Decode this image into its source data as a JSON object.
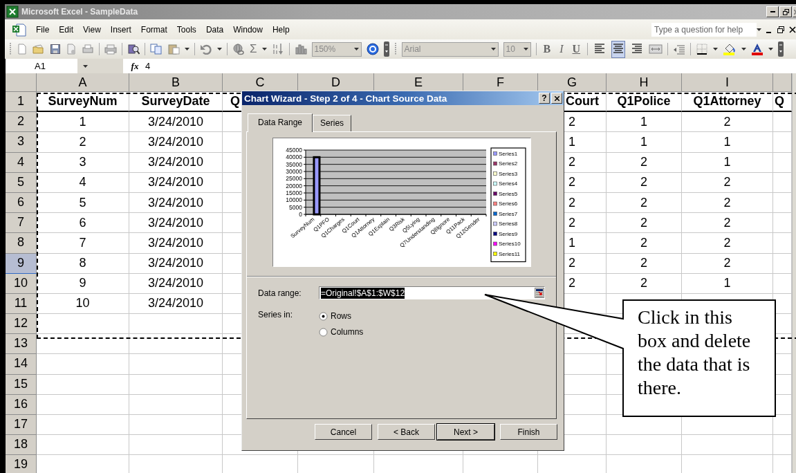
{
  "window": {
    "title": "Microsoft Excel - SampleData"
  },
  "menu": {
    "items": [
      "File",
      "Edit",
      "View",
      "Insert",
      "Format",
      "Tools",
      "Data",
      "Window",
      "Help"
    ],
    "help_search": {
      "placeholder": "Type a question for help"
    }
  },
  "toolbar": {
    "autosum": "Σ",
    "zoom": "150%",
    "font": "Arial",
    "font_size": "10",
    "styles": [
      "B",
      "I",
      "U"
    ],
    "alignment_buttons": [
      {
        "kind": "left",
        "pressed": false
      },
      {
        "kind": "center",
        "pressed": true
      },
      {
        "kind": "right",
        "pressed": false
      }
    ]
  },
  "formula_bar": {
    "cell": "A1",
    "fx": "fx",
    "value": "4"
  },
  "sheet": {
    "columns": [
      "A",
      "B",
      "C",
      "D",
      "E",
      "F",
      "G",
      "H",
      "I"
    ],
    "rows": [
      {
        "label": "1",
        "selected": false,
        "cells": [
          "SurveyNum",
          "SurveyDate",
          "Q",
          null,
          null,
          null,
          "Court",
          "Q1Police",
          "Q1Attorney",
          "Q"
        ]
      },
      {
        "label": "2",
        "selected": false,
        "cells": [
          "1",
          "3/24/2010",
          null,
          null,
          null,
          null,
          "2",
          "1",
          "2",
          null
        ]
      },
      {
        "label": "3",
        "selected": false,
        "cells": [
          "2",
          "3/24/2010",
          null,
          null,
          null,
          null,
          "1",
          "1",
          "1",
          null
        ]
      },
      {
        "label": "4",
        "selected": false,
        "cells": [
          "3",
          "3/24/2010",
          null,
          null,
          null,
          null,
          "2",
          "2",
          "1",
          null
        ]
      },
      {
        "label": "5",
        "selected": false,
        "cells": [
          "4",
          "3/24/2010",
          null,
          null,
          null,
          null,
          "2",
          "2",
          "2",
          null
        ]
      },
      {
        "label": "6",
        "selected": false,
        "cells": [
          "5",
          "3/24/2010",
          null,
          null,
          null,
          null,
          "2",
          "2",
          "2",
          null
        ]
      },
      {
        "label": "7",
        "selected": false,
        "cells": [
          "6",
          "3/24/2010",
          null,
          null,
          null,
          null,
          "2",
          "2",
          "2",
          null
        ]
      },
      {
        "label": "8",
        "selected": false,
        "cells": [
          "7",
          "3/24/2010",
          null,
          null,
          null,
          null,
          "1",
          "2",
          "2",
          null
        ]
      },
      {
        "label": "9",
        "selected": true,
        "cells": [
          "8",
          "3/24/2010",
          null,
          null,
          null,
          null,
          "2",
          "2",
          "2",
          null
        ]
      },
      {
        "label": "10",
        "selected": false,
        "cells": [
          "9",
          "3/24/2010",
          null,
          null,
          null,
          null,
          "2",
          "2",
          "1",
          null
        ]
      },
      {
        "label": "11",
        "selected": false,
        "cells": [
          "10",
          "3/24/2010",
          null,
          null,
          null,
          null,
          null,
          null,
          null,
          null
        ]
      },
      {
        "label": "12",
        "selected": false
      },
      {
        "label": "13",
        "selected": false
      },
      {
        "label": "14",
        "selected": false
      },
      {
        "label": "15",
        "selected": false
      },
      {
        "label": "16",
        "selected": false
      },
      {
        "label": "17",
        "selected": false
      },
      {
        "label": "18",
        "selected": false
      },
      {
        "label": "19",
        "selected": false
      }
    ]
  },
  "dialog": {
    "title": "Chart Wizard - Step 2 of 4 - Chart Source Data",
    "help_button": "?",
    "tabs": [
      {
        "label": "Data Range",
        "selected": true
      },
      {
        "label": "Series",
        "selected": false
      }
    ],
    "preview": {
      "chart_data": {
        "type": "bar",
        "categories": [
          "SurveyNum",
          "Q1PFO",
          "Q1Charges",
          "Q1Court",
          "Q1Attorney",
          "Q1Explain",
          "Q3Risk",
          "Q5Lying",
          "Q7Understanding",
          "Q8Ignore",
          "Q11Pack",
          "Q12Gender"
        ],
        "grid": true,
        "ylim": [
          0,
          45000
        ],
        "yticks": [
          0,
          5000,
          10000,
          15000,
          20000,
          25000,
          30000,
          35000,
          40000,
          45000
        ],
        "series": [
          {
            "name": "Series1",
            "color": "#9999ff",
            "values": [
              40000,
              null,
              null,
              null,
              null,
              null,
              null,
              null,
              null,
              null,
              null,
              null
            ]
          },
          {
            "name": "Series2",
            "color": "#993366",
            "values": [
              null,
              null,
              null,
              null,
              null,
              null,
              null,
              null,
              null,
              null,
              null,
              null
            ]
          },
          {
            "name": "Series3",
            "color": "#ffffcc",
            "values": [
              null,
              null,
              null,
              null,
              null,
              null,
              null,
              null,
              null,
              null,
              null,
              null
            ]
          },
          {
            "name": "Series4",
            "color": "#ccffff",
            "values": [
              null,
              null,
              null,
              null,
              null,
              null,
              null,
              null,
              null,
              null,
              null,
              null
            ]
          },
          {
            "name": "Series5",
            "color": "#660066",
            "values": [
              null,
              null,
              null,
              null,
              null,
              null,
              null,
              null,
              null,
              null,
              null,
              null
            ]
          },
          {
            "name": "Series6",
            "color": "#ff8080",
            "values": [
              null,
              null,
              null,
              null,
              null,
              null,
              null,
              null,
              null,
              null,
              null,
              null
            ]
          },
          {
            "name": "Series7",
            "color": "#0066cc",
            "values": [
              null,
              null,
              null,
              null,
              null,
              null,
              null,
              null,
              null,
              null,
              null,
              null
            ]
          },
          {
            "name": "Series8",
            "color": "#ccccff",
            "values": [
              null,
              null,
              null,
              null,
              null,
              null,
              null,
              null,
              null,
              null,
              null,
              null
            ]
          },
          {
            "name": "Series9",
            "color": "#000080",
            "values": [
              null,
              null,
              null,
              null,
              null,
              null,
              null,
              null,
              null,
              null,
              null,
              null
            ]
          },
          {
            "name": "Series10",
            "color": "#ff00ff",
            "values": [
              null,
              null,
              null,
              null,
              null,
              null,
              null,
              null,
              null,
              null,
              null,
              null
            ]
          },
          {
            "name": "Series11",
            "color": "#ffff00",
            "values": [
              null,
              null,
              null,
              null,
              null,
              null,
              null,
              null,
              null,
              null,
              null,
              null
            ]
          }
        ]
      }
    },
    "data_range": {
      "label": "Data range:",
      "value": "=Original!$A$1:$W$12",
      "highlighted": true
    },
    "series_in": {
      "label": "Series in:",
      "options": [
        {
          "label": "Rows",
          "selected": true
        },
        {
          "label": "Columns",
          "selected": false
        }
      ]
    },
    "buttons": [
      {
        "label": "Cancel",
        "default": false
      },
      {
        "label": "< Back",
        "default": false
      },
      {
        "label": "Next >",
        "default": true
      },
      {
        "label": "Finish",
        "default": false
      }
    ]
  },
  "callout": {
    "text": "Click in this box and delete the data that is there."
  }
}
